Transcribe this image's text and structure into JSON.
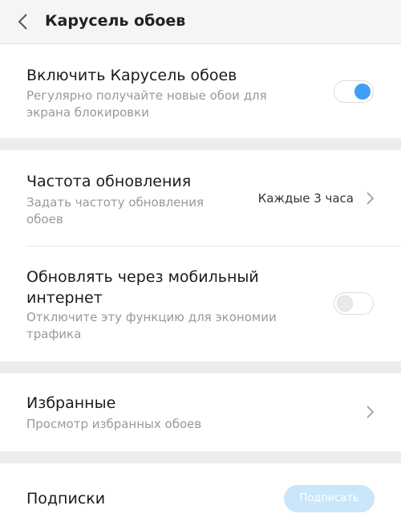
{
  "header": {
    "title": "Карусель обоев",
    "back_icon": "chevron-left-icon"
  },
  "wallpaper_carousel": {
    "title": "Включить Карусель обоев",
    "subtitle": "Регулярно получайте новые обои для экрана блокировки",
    "toggle_on": true
  },
  "update_frequency": {
    "title": "Частота обновления",
    "subtitle": "Задать частоту обновления обоев",
    "value": "Каждые 3 часа",
    "chevron_icon": "chevron-right-icon"
  },
  "mobile_data": {
    "title": "Обновлять через мобильный интернет",
    "subtitle": "Отключите эту функцию для экономии трафика",
    "toggle_on": false
  },
  "favorites": {
    "title": "Избранные",
    "subtitle": "Просмотр избранных обоев",
    "chevron_icon": "chevron-right-icon"
  },
  "subscriptions": {
    "title": "Подписки",
    "button_label": "Подписать"
  },
  "colors": {
    "accent": "#3e9ef5",
    "button_bg": "#c9e6fb",
    "page_bg": "#ececec",
    "secondary_text": "#999999"
  }
}
